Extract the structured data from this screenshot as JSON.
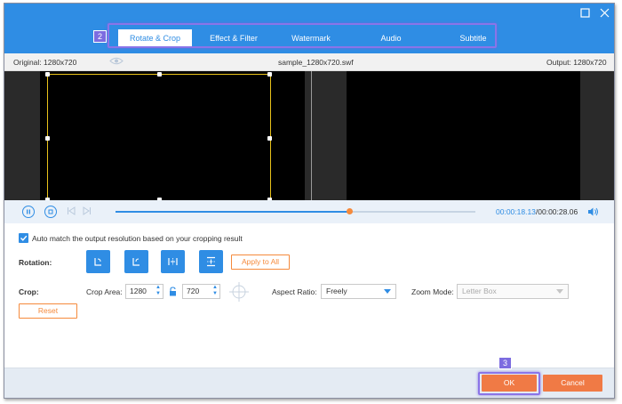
{
  "window": {
    "maximize_icon": "maximize-icon",
    "close_icon": "close-icon",
    "accent": "#2f8de4"
  },
  "tabs": [
    {
      "label": "Rotate & Crop",
      "active": true
    },
    {
      "label": "Effect & Filter",
      "active": false
    },
    {
      "label": "Watermark",
      "active": false
    },
    {
      "label": "Audio",
      "active": false
    },
    {
      "label": "Subtitle",
      "active": false
    }
  ],
  "badges": {
    "tabs_badge": "2",
    "ok_badge": "3",
    "highlight_color": "#8b74e8"
  },
  "infobar": {
    "original": "Original: 1280x720",
    "filename": "sample_1280x720.swf",
    "output": "Output: 1280x720",
    "eye_icon": "eye-icon"
  },
  "playback": {
    "current_time": "00:00:18.13",
    "total_time": "/00:00:28.06",
    "progress": 0.65,
    "knob_color": "#f58a3c"
  },
  "settings": {
    "auto_match_label": "Auto match the output resolution based on your cropping result",
    "auto_match_checked": true,
    "rotation_label": "Rotation:",
    "apply_to_all": "Apply to All",
    "crop_label": "Crop:",
    "crop_area_label": "Crop Area:",
    "crop_width": "1280",
    "crop_height": "720",
    "aspect_ratio_label": "Aspect Ratio:",
    "aspect_ratio_value": "Freely",
    "zoom_mode_label": "Zoom Mode:",
    "zoom_mode_value": "Letter Box",
    "reset_label": "Reset"
  },
  "footer": {
    "ok_label": "OK",
    "cancel_label": "Cancel",
    "button_color": "#f07a45"
  }
}
